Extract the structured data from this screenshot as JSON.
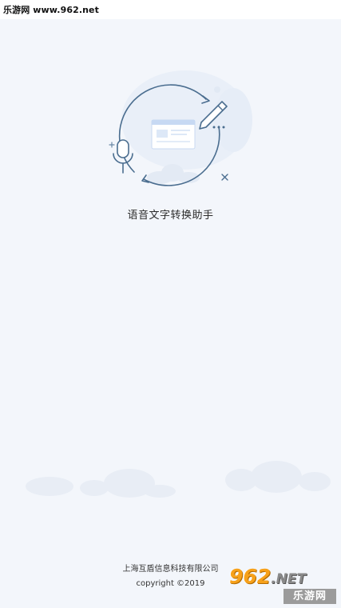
{
  "status_bar": {
    "text": "乐游网 www.962.net"
  },
  "splash": {
    "app_title": "语音文字转换助手",
    "company": "上海互盾信息科技有限公司",
    "copyright": "copyright ©2019"
  },
  "watermark": {
    "number": "962",
    "suffix": ".NET",
    "site_name": "乐游网"
  },
  "icons": {
    "illustration": "voice-to-text-illustration",
    "microphone": "microphone-icon",
    "pencil": "pencil-icon"
  },
  "colors": {
    "background": "#f3f6fb",
    "illustration_line": "#4a6d8f",
    "illustration_light": "#a9c3ea",
    "cloud": "#e6ecf5",
    "watermark_orange": "#f7a11a"
  }
}
